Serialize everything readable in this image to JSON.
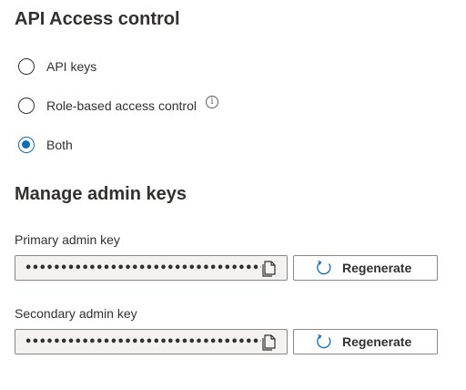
{
  "api_access": {
    "title": "API Access control",
    "options": [
      {
        "label": "API keys",
        "selected": false
      },
      {
        "label": "Role-based access control",
        "selected": false,
        "info": true
      },
      {
        "label": "Both",
        "selected": true
      }
    ]
  },
  "admin_keys": {
    "title": "Manage admin keys",
    "primary": {
      "label": "Primary admin key",
      "value": "••••••••••••••••••••••••••••••••••••••",
      "regenerate_label": "Regenerate"
    },
    "secondary": {
      "label": "Secondary admin key",
      "value": "••••••••••••••••••••••••••••••••••••••",
      "regenerate_label": "Regenerate"
    }
  },
  "icons": {
    "info": "info-icon",
    "copy": "copy-icon",
    "regenerate": "refresh-icon"
  },
  "colors": {
    "accent": "#0f6cbd",
    "field_background": "#f3f2f1",
    "text": "#323130"
  }
}
